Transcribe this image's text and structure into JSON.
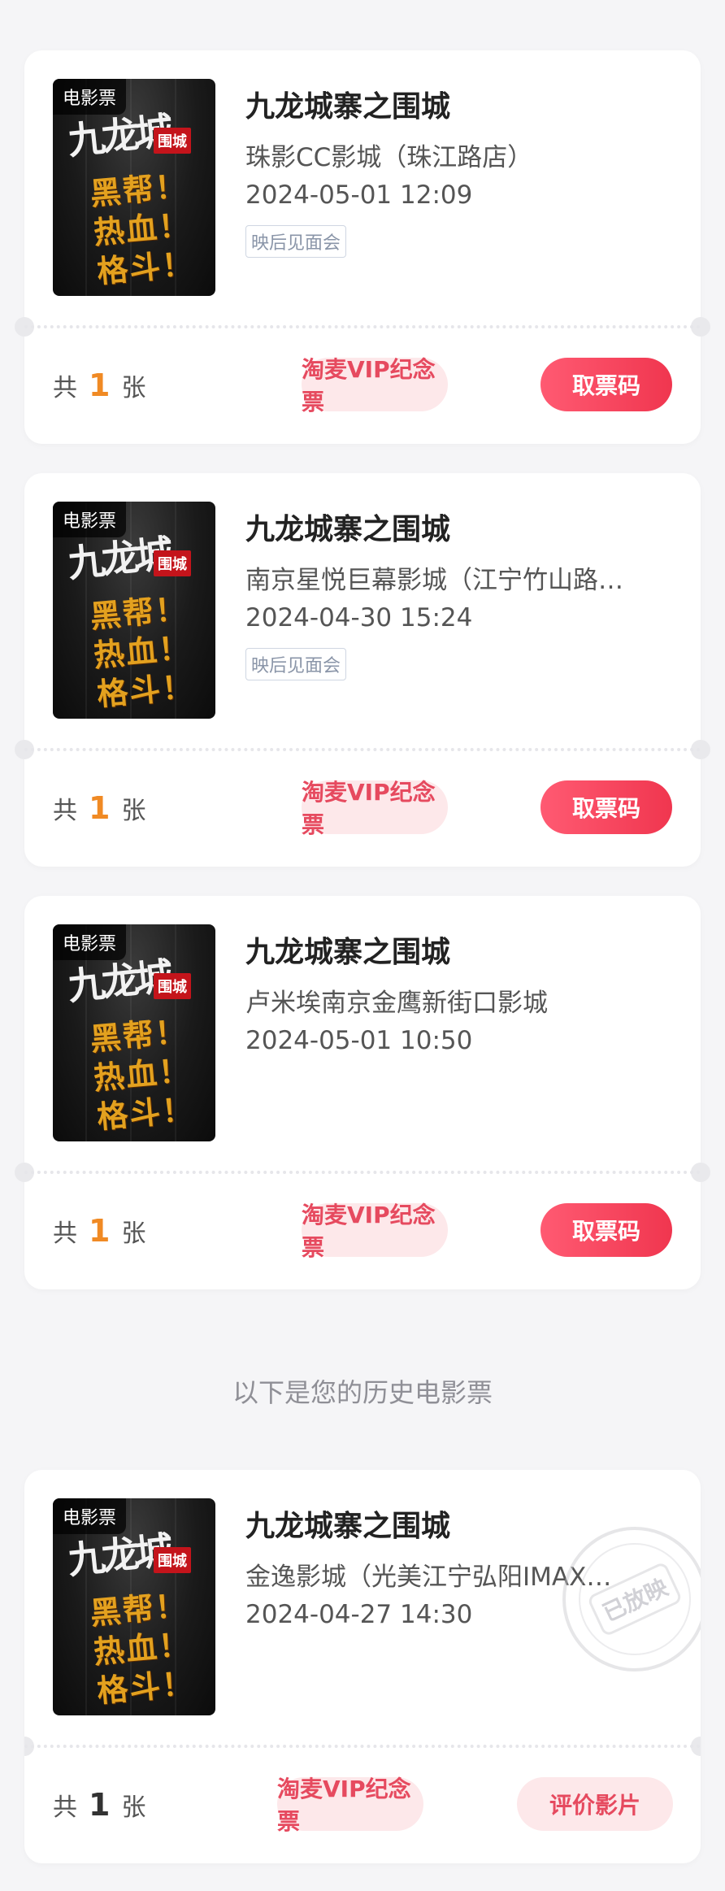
{
  "tickets": [
    {
      "poster_tag": "电影票",
      "poster_title_mark": "九龙城",
      "poster_seal": "围城",
      "poster_slogan": "黑帮！热血！格斗！",
      "title": "九龙城寨之围城",
      "cinema": "珠影CC影城（珠江路店）",
      "datetime": "2024-05-01 12:09",
      "event_tag": "映后见面会",
      "count_prefix": "共",
      "count": "1",
      "count_suffix": "张",
      "vip_button": "淘麦VIP纪念票",
      "action_button": "取票码"
    },
    {
      "poster_tag": "电影票",
      "poster_title_mark": "九龙城",
      "poster_seal": "围城",
      "poster_slogan": "黑帮！热血！格斗！",
      "title": "九龙城寨之围城",
      "cinema": "南京星悦巨幕影城（江宁竹山路…",
      "datetime": "2024-04-30 15:24",
      "event_tag": "映后见面会",
      "count_prefix": "共",
      "count": "1",
      "count_suffix": "张",
      "vip_button": "淘麦VIP纪念票",
      "action_button": "取票码"
    },
    {
      "poster_tag": "电影票",
      "poster_title_mark": "九龙城",
      "poster_seal": "围城",
      "poster_slogan": "黑帮！热血！格斗！",
      "title": "九龙城寨之围城",
      "cinema": "卢米埃南京金鹰新街口影城",
      "datetime": "2024-05-01 10:50",
      "count_prefix": "共",
      "count": "1",
      "count_suffix": "张",
      "vip_button": "淘麦VIP纪念票",
      "action_button": "取票码"
    }
  ],
  "history_note": "以下是您的历史电影票",
  "history_ticket": {
    "poster_tag": "电影票",
    "poster_title_mark": "九龙城",
    "poster_seal": "围城",
    "poster_slogan": "黑帮！热血！格斗！",
    "title": "九龙城寨之围城",
    "cinema": "金逸影城（光美江宁弘阳IMAX…",
    "datetime": "2024-04-27 14:30",
    "stamp": "已放映",
    "count_prefix": "共",
    "count": "1",
    "count_suffix": "张",
    "vip_button": "淘麦VIP纪念票",
    "action_button": "评价影片"
  },
  "colors": {
    "accent": "#f0364f",
    "vip_bg": "#fde8ea",
    "count_highlight": "#f08a24"
  }
}
